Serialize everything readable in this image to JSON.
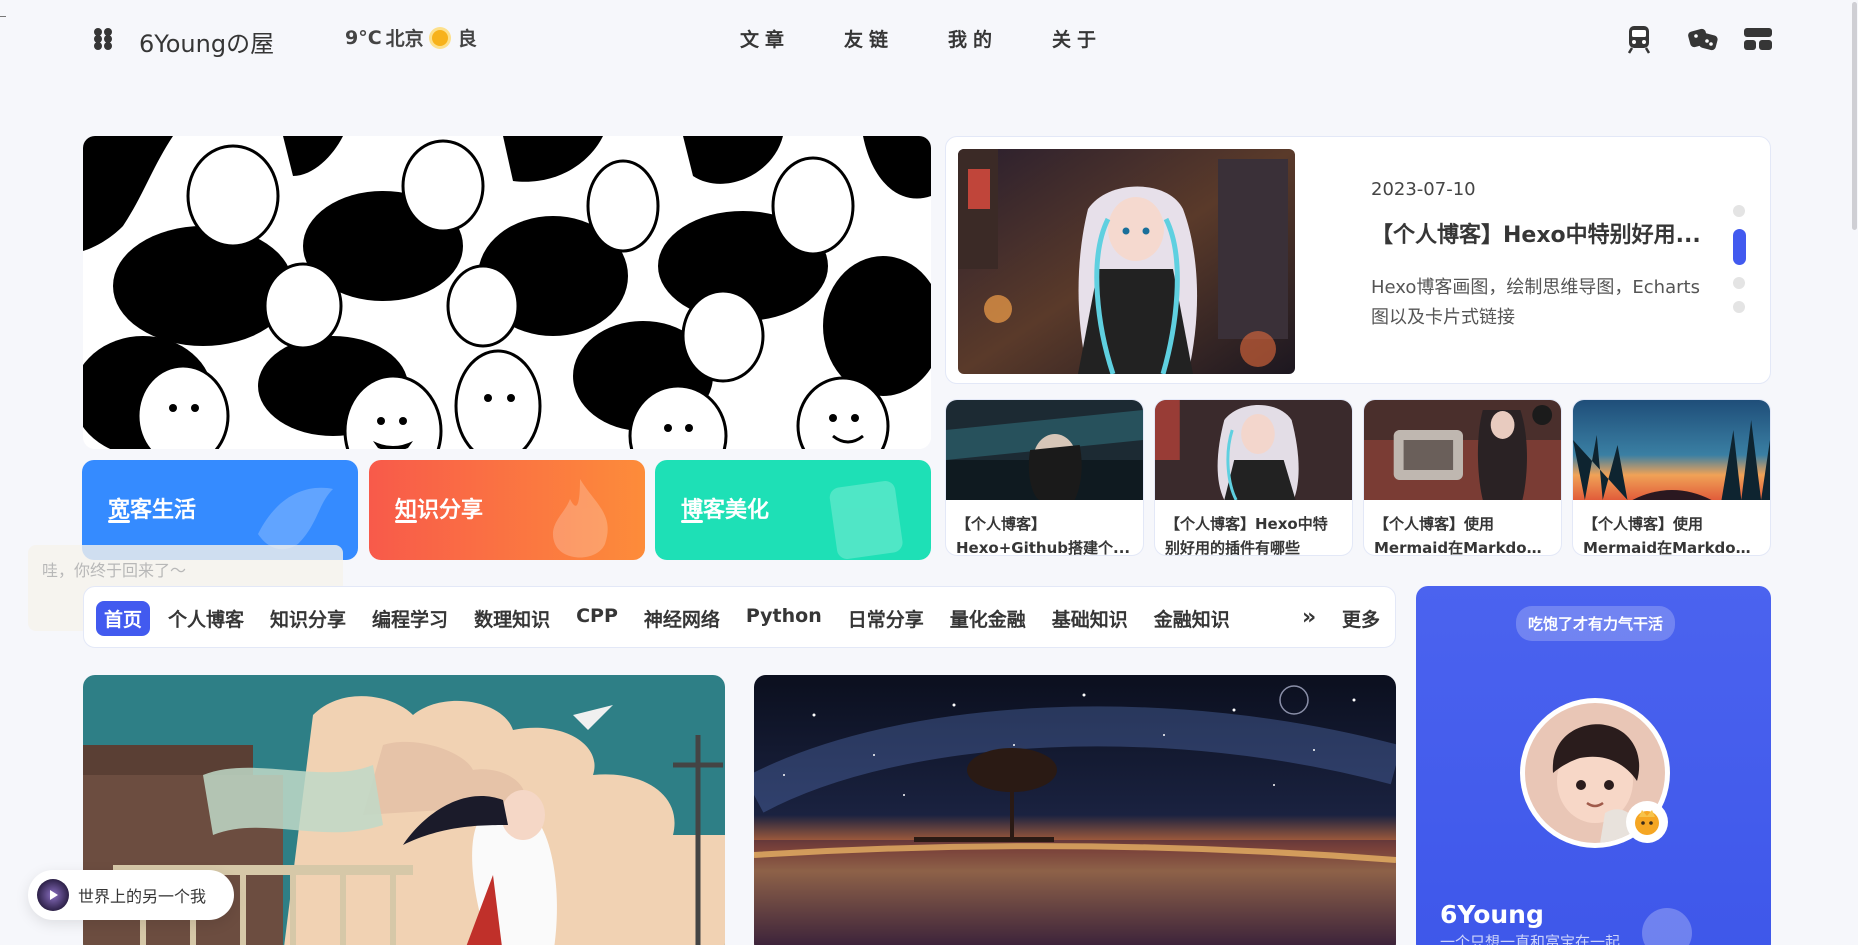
{
  "header": {
    "site_title": "6Youngの屋",
    "weather": {
      "temp": "9°C",
      "city": "北京",
      "quality": "良"
    },
    "nav": [
      "文章",
      "友链",
      "我的",
      "关于"
    ],
    "icons": [
      "subway-icon",
      "game-icon",
      "category-icon"
    ]
  },
  "categories": [
    {
      "label": "宽客生活",
      "color": "#358bff"
    },
    {
      "label": "知识分享",
      "color": "#f86a48"
    },
    {
      "label": "博客美化",
      "color": "#1ee0b6"
    }
  ],
  "feature": {
    "date": "2023-07-10",
    "title": "【个人博客】Hexo中特别好用...",
    "desc": "Hexo博客画图，绘制思维导图，Echarts图以及卡片式链接",
    "active_dot": 1
  },
  "minicards": [
    {
      "line1": "【个人博客】",
      "line2": "Hexo+Github搭建个..."
    },
    {
      "line1": "【个人博客】Hexo中特",
      "line2": "别好用的插件有哪些"
    },
    {
      "line1": "【个人博客】使用",
      "line2": "Mermaid在Markdow..."
    },
    {
      "line1": "【个人博客】使用",
      "line2": "Mermaid在Markdow..."
    }
  ],
  "greeting": "哇，你终于回来了～",
  "catbar": {
    "items": [
      "首页",
      "个人博客",
      "知识分享",
      "编程学习",
      "数理知识",
      "CPP",
      "神经网络",
      "Python",
      "日常分享",
      "量化金融",
      "基础知识",
      "金融知识"
    ],
    "active_index": 0,
    "more": "更多",
    "more_arrow": "»"
  },
  "author": {
    "tag": "吃饱了才有力气干活",
    "name": "6Young",
    "desc": "一个只想一直和富宝在一起"
  },
  "music": {
    "title": "世界上的另一个我"
  },
  "colors": {
    "accent": "#425aef",
    "bg": "#f6f7fb"
  }
}
